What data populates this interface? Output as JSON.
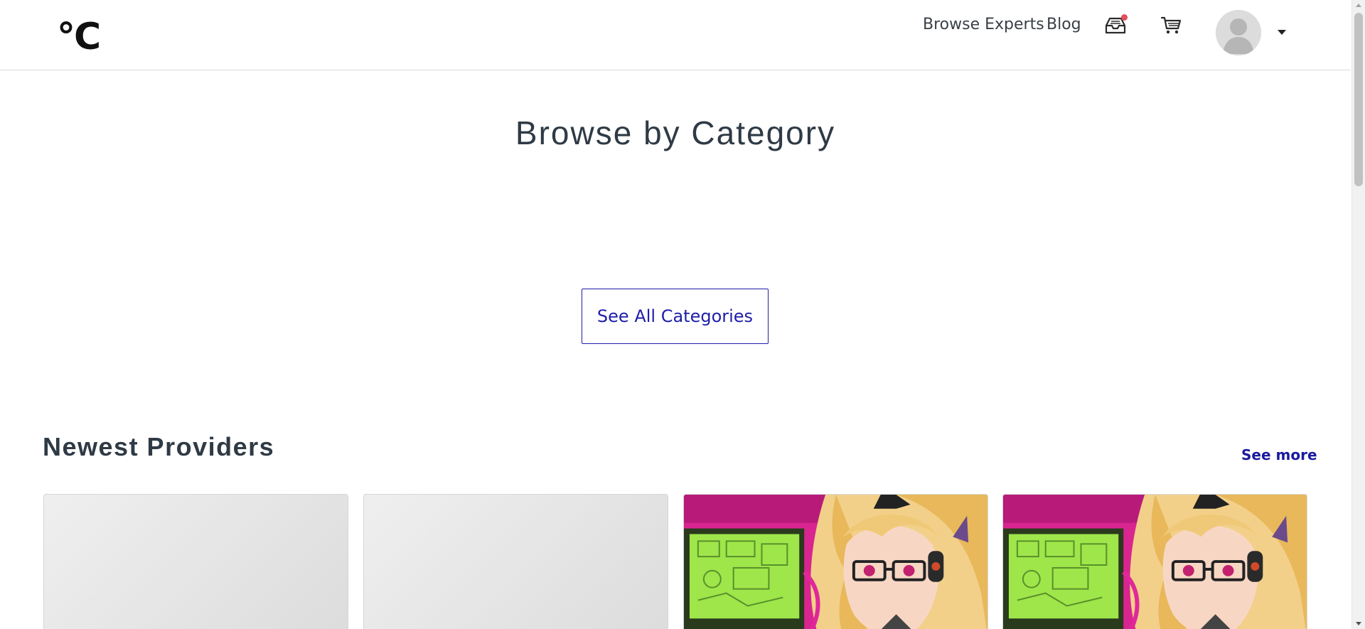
{
  "header": {
    "logo_text": "°C",
    "nav": {
      "browse_experts": "Browse Experts",
      "blog": "Blog"
    },
    "icons": {
      "inbox": "inbox-icon",
      "cart": "cart-icon",
      "avatar": "user-avatar",
      "menu": "chevron-down-icon"
    },
    "notification_color": "#e0505a"
  },
  "main": {
    "category_title": "Browse by Category",
    "see_all_label": "See All Categories",
    "providers_title": "Newest Providers",
    "see_more_label": "See more"
  },
  "colors": {
    "accent": "#1e1ea8",
    "heading": "#2f3a45",
    "card_art_primary": "#e0289a",
    "card_art_secondary": "#9ee64a"
  },
  "providers": [
    {
      "state": "loading"
    },
    {
      "state": "loading"
    },
    {
      "state": "image",
      "image": "anime-girl-headphones-glasses"
    },
    {
      "state": "image",
      "image": "anime-girl-headphones-glasses"
    }
  ]
}
